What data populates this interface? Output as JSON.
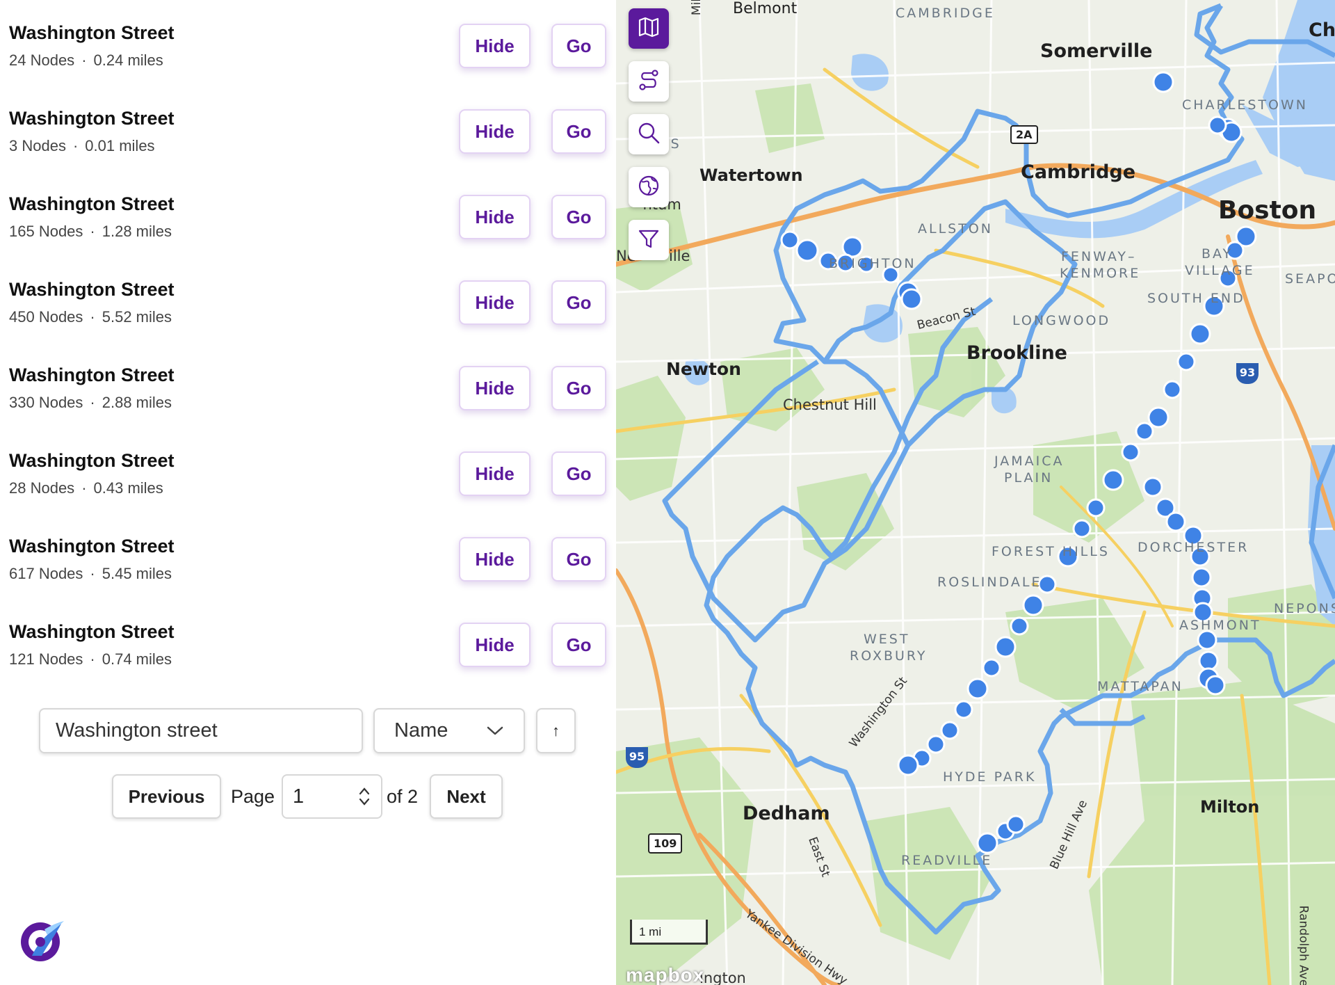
{
  "routes": [
    {
      "name": "Washington Street",
      "nodes": "24 Nodes",
      "distance": "0.24 miles"
    },
    {
      "name": "Washington Street",
      "nodes": "3 Nodes",
      "distance": "0.01 miles"
    },
    {
      "name": "Washington Street",
      "nodes": "165 Nodes",
      "distance": "1.28 miles"
    },
    {
      "name": "Washington Street",
      "nodes": "450 Nodes",
      "distance": "5.52 miles"
    },
    {
      "name": "Washington Street",
      "nodes": "330 Nodes",
      "distance": "2.88 miles"
    },
    {
      "name": "Washington Street",
      "nodes": "28 Nodes",
      "distance": "0.43 miles"
    },
    {
      "name": "Washington Street",
      "nodes": "617 Nodes",
      "distance": "5.45 miles"
    },
    {
      "name": "Washington Street",
      "nodes": "121 Nodes",
      "distance": "0.74 miles"
    }
  ],
  "row_actions": {
    "hide_label": "Hide",
    "go_label": "Go",
    "separator": "·"
  },
  "search": {
    "value": "Washington street"
  },
  "sort": {
    "selected": "Name",
    "direction_icon": "arrow-up-icon",
    "direction_glyph": "↑"
  },
  "pagination": {
    "previous_label": "Previous",
    "page_label": "Page",
    "current_page": "1",
    "of_label": "of 2",
    "next_label": "Next"
  },
  "map": {
    "tools": [
      "map-icon",
      "route-icon",
      "search-icon",
      "globe-icon",
      "filter-icon"
    ],
    "labels": {
      "belmont": "Belmont",
      "cambridge_north": "CAMBRIDGE",
      "somerville": "Somerville",
      "che": "Che",
      "charlestown": "CHARLESTOWN",
      "route_2a": "2A",
      "cambridge": "Cambridge",
      "watertown": "Watertown",
      "is": "IS",
      "antum": "˄ntum",
      "boston": "Boston",
      "allston": "ALLSTON",
      "ne": "Ne",
      "ille": "ille",
      "brighton": "BRIGHTON",
      "fenway": "FENWAY–",
      "kenmore": "KENMORE",
      "bay": "BAY",
      "village": "VILLAGE",
      "seapo": "SEAPO",
      "south_end": "SOUTH END",
      "beacon_st": "Beacon St",
      "longwood": "LONGWOOD",
      "brookline": "Brookline",
      "newton": "Newton",
      "i93": "93",
      "chestnut_hill": "Chestnut Hill",
      "jamaica": "JAMAICA",
      "plain": "PLAIN",
      "dorchester": "DORCHESTER",
      "forest_hills": "FOREST HILLS",
      "roslindale": "ROSLINDALE",
      "neponse": "NEPONSE",
      "ashmont": "ASHMONT",
      "west": "WEST",
      "roxbury": "ROXBURY",
      "washington_st": "Washington St",
      "mattapan": "MATTAPAN",
      "hyde_park": "HYDE PARK",
      "i95": "95",
      "milton": "Milton",
      "dedham": "Dedham",
      "blue_hill_ave": "Blue Hill Ave",
      "route_109": "109",
      "east_st": "East St",
      "readville": "READVILLE",
      "yankee": "Yankee Division Hwy",
      "randolph": "Randolph Ave",
      "mil": "Mil",
      "ington": "ington"
    },
    "scale": "1 mi",
    "attribution": "mapbox",
    "colors": {
      "route": "#6aa6ea",
      "node": "#3f83e6",
      "accent": "#5b1a9c"
    }
  }
}
